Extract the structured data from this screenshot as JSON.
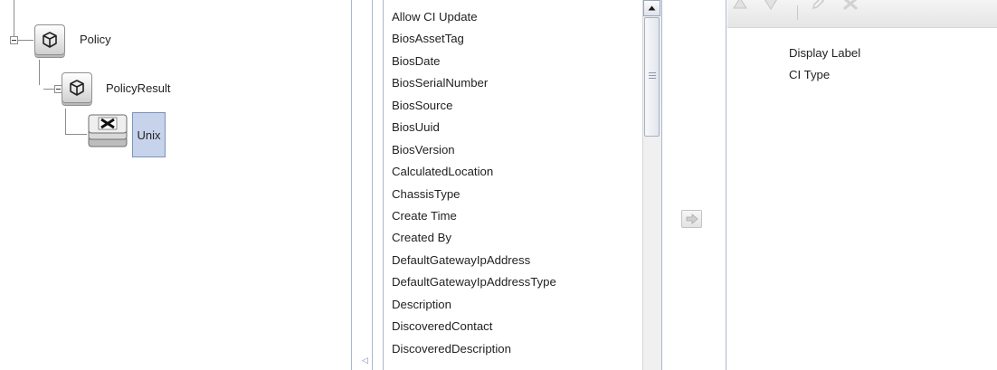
{
  "tree": {
    "root": {
      "label": "Policy",
      "icon": "ci-cube-icon"
    },
    "child": {
      "label": "PolicyResult",
      "icon": "ci-cube-icon"
    },
    "leaf": {
      "label": "Unix",
      "icon": "unix-node-icon"
    }
  },
  "attributes": {
    "items": [
      "Allow CI Update",
      "BiosAssetTag",
      "BiosDate",
      "BiosSerialNumber",
      "BiosSource",
      "BiosUuid",
      "BiosVersion",
      "CalculatedLocation",
      "ChassisType",
      "Create Time",
      "Created By",
      "DefaultGatewayIpAddress",
      "DefaultGatewayIpAddressType",
      "Description",
      "DiscoveredContact",
      "DiscoveredDescription"
    ]
  },
  "selected": {
    "items": [
      "Display Label",
      "CI Type"
    ]
  },
  "colors": {
    "selection": "#c6d3ea",
    "divider": "#a9b7cc"
  }
}
